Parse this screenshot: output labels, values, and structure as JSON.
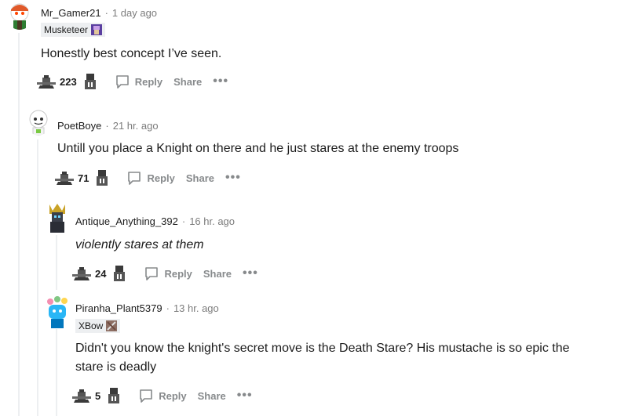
{
  "comments": [
    {
      "username": "Mr_Gamer21",
      "time": "1 day ago",
      "flair": "Musketeer",
      "body": "Honestly best concept I’ve seen.",
      "score": "223",
      "reply_label": "Reply",
      "share_label": "Share",
      "more_label": "•••"
    },
    {
      "username": "PoetBoye",
      "time": "21 hr. ago",
      "body": "Untill you place a Knight on there and he just stares at the enemy troops",
      "score": "71",
      "reply_label": "Reply",
      "share_label": "Share",
      "more_label": "•••"
    },
    {
      "username": "Antique_Anything_392",
      "time": "16 hr. ago",
      "body": "violently stares at them",
      "score": "24",
      "reply_label": "Reply",
      "share_label": "Share",
      "more_label": "•••"
    },
    {
      "username": "Piranha_Plant5379",
      "time": "13 hr. ago",
      "flair": "XBow",
      "body": "Didn't you know the knight's secret move is the Death Stare? His mustache is so epic the stare is deadly",
      "score": "5",
      "reply_label": "Reply",
      "share_label": "Share",
      "more_label": "•••"
    }
  ],
  "separator": "·",
  "icons": {
    "upvote": "knight-upvote-icon",
    "downvote": "knight-downvote-icon",
    "reply": "speech-bubble-icon"
  },
  "colors": {
    "meta_gray": "#7c7c7c",
    "action_gray": "#878a8c",
    "thread_line": "#edeff1",
    "flair_bg": "#edeff1"
  }
}
